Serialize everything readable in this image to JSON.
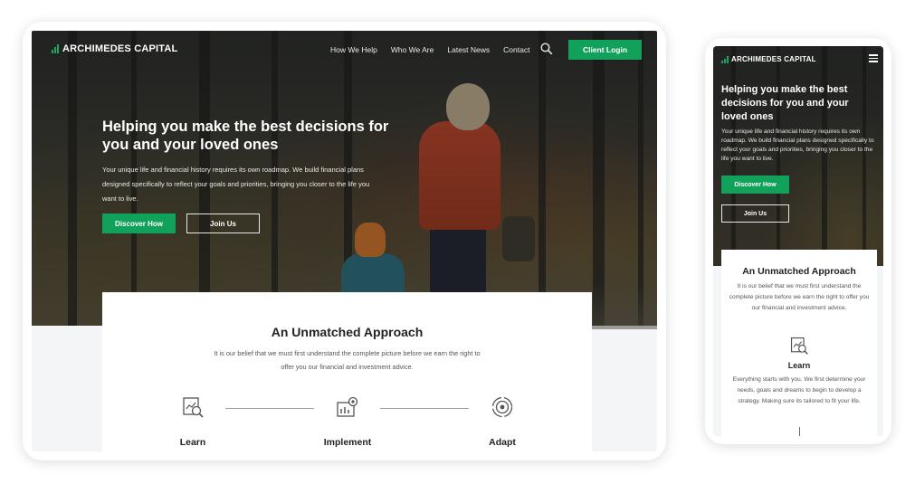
{
  "brand": {
    "name": "ARCHIMEDES CAPITAL",
    "accent_color": "#12a15a"
  },
  "nav": {
    "links": [
      "How We Help",
      "Who We Are",
      "Latest News",
      "Contact"
    ],
    "search_icon": "search-icon",
    "client_login": "Client Login",
    "menu_icon": "hamburger-menu-icon"
  },
  "hero": {
    "title": "Helping you make the best decisions for you and your loved ones",
    "text": "Your unique life and financial history requires its own roadmap. We build financial plans designed specifically to reflect your goals and priorities, bringing you closer to the life you want to live.",
    "primary_button": "Discover How",
    "secondary_button": "Join Us"
  },
  "approach": {
    "title": "An Unmatched Approach",
    "text": "It is our belief that we must first understand the complete picture before we earn the right to offer you our financial and investment advice.",
    "steps": [
      {
        "label": "Learn",
        "icon": "analysis-report-icon",
        "text": "Everything starts with you. We first determine your needs, goals and dreams to begin to develop a strategy. Making sure its tailored to fit your life."
      },
      {
        "label": "Implement",
        "icon": "settings-chart-icon"
      },
      {
        "label": "Adapt",
        "icon": "target-cycle-icon"
      }
    ]
  }
}
